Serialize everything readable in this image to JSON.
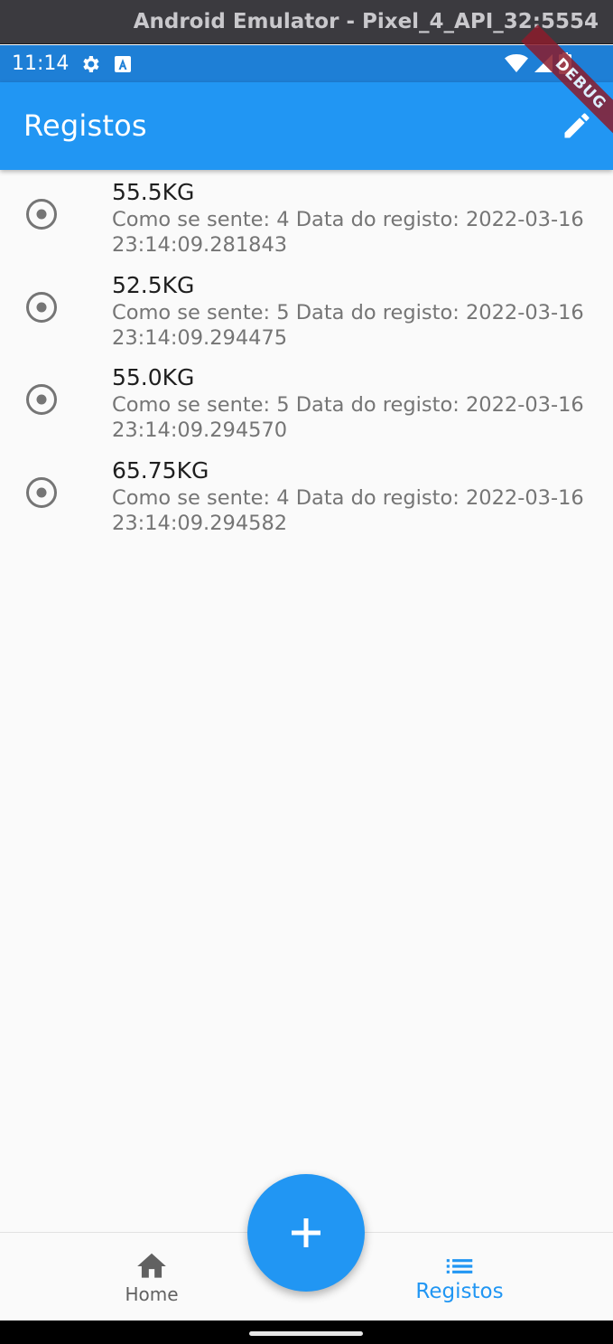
{
  "window": {
    "title": "Android Emulator - Pixel_4_API_32:5554"
  },
  "status_bar": {
    "time": "11:14"
  },
  "app_bar": {
    "title": "Registos",
    "action_icon": "edit-icon"
  },
  "debug_banner": "DEBUG",
  "colors": {
    "primary": "#2196f3",
    "status_bar": "#1e7fd6",
    "subtitle": "#757575"
  },
  "records": [
    {
      "title": "55.5KG",
      "subtitle": "Como se sente: 4  Data do registo: 2022-03-16 23:14:09.281843"
    },
    {
      "title": "52.5KG",
      "subtitle": "Como se sente: 5  Data do registo: 2022-03-16 23:14:09.294475"
    },
    {
      "title": "55.0KG",
      "subtitle": "Como se sente: 5  Data do registo: 2022-03-16 23:14:09.294570"
    },
    {
      "title": "65.75KG",
      "subtitle": "Como se sente: 4  Data do registo: 2022-03-16 23:14:09.294582"
    }
  ],
  "bottom_nav": {
    "items": [
      {
        "label": "Home",
        "icon": "home-icon",
        "selected": false
      },
      {
        "label": "Registos",
        "icon": "list-icon",
        "selected": true
      }
    ]
  },
  "fab": {
    "icon": "plus-icon"
  }
}
